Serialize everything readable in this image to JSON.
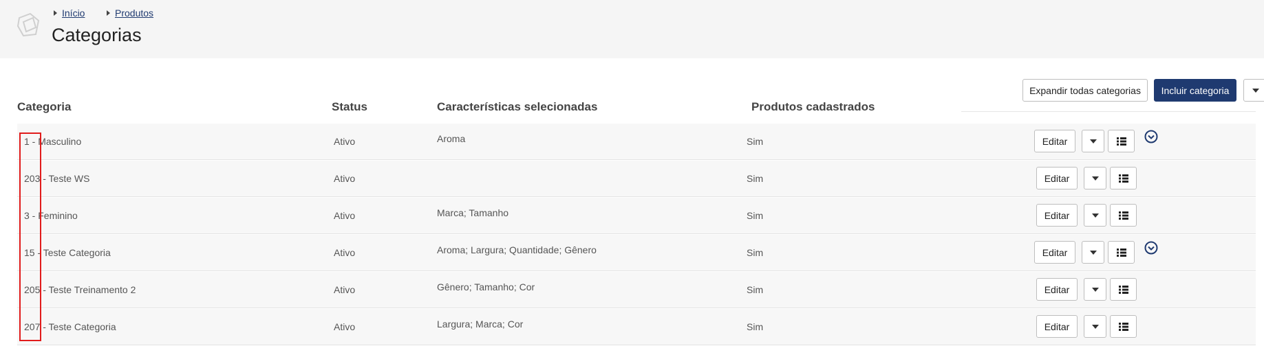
{
  "breadcrumb": [
    {
      "label": "Início"
    },
    {
      "label": "Produtos"
    }
  ],
  "page": {
    "title": "Categorias"
  },
  "toolbar": {
    "expand_all_label": "Expandir todas categorias",
    "include_label": "Incluir categoria"
  },
  "table": {
    "headers": {
      "category": "Categoria",
      "status": "Status",
      "features": "Características selecionadas",
      "products": "Produtos cadastrados"
    },
    "rows": [
      {
        "category": "1 - Masculino",
        "status": "Ativo",
        "features": "Aroma",
        "products": "Sim",
        "edit_label": "Editar",
        "has_children": true
      },
      {
        "category": "203 - Teste WS",
        "status": "Ativo",
        "features": "",
        "products": "Sim",
        "edit_label": "Editar",
        "has_children": false
      },
      {
        "category": "3 - Feminino",
        "status": "Ativo",
        "features": "Marca; Tamanho",
        "products": "Sim",
        "edit_label": "Editar",
        "has_children": false
      },
      {
        "category": "15 - Teste Categoria",
        "status": "Ativo",
        "features": "Aroma; Largura; Quantidade; Gênero",
        "products": "Sim",
        "edit_label": "Editar",
        "has_children": true
      },
      {
        "category": "205 - Teste Treinamento 2",
        "status": "Ativo",
        "features": "Gênero; Tamanho; Cor",
        "products": "Sim",
        "edit_label": "Editar",
        "has_children": false
      },
      {
        "category": "207 - Teste Categoria",
        "status": "Ativo",
        "features": "Largura; Marca; Cor",
        "products": "Sim",
        "edit_label": "Editar",
        "has_children": false
      }
    ]
  },
  "colors": {
    "primary": "#1f3a70",
    "highlight": "#e11b1b",
    "row_bg": "#f7f7f7",
    "header_bg": "#f5f5f5"
  },
  "icons": {
    "logo": "cube-outline-icon",
    "breadcrumb_separator": "caret-right-icon",
    "dropdown": "caret-down-icon",
    "list": "list-icon",
    "expand": "chevron-circle-down-icon"
  }
}
